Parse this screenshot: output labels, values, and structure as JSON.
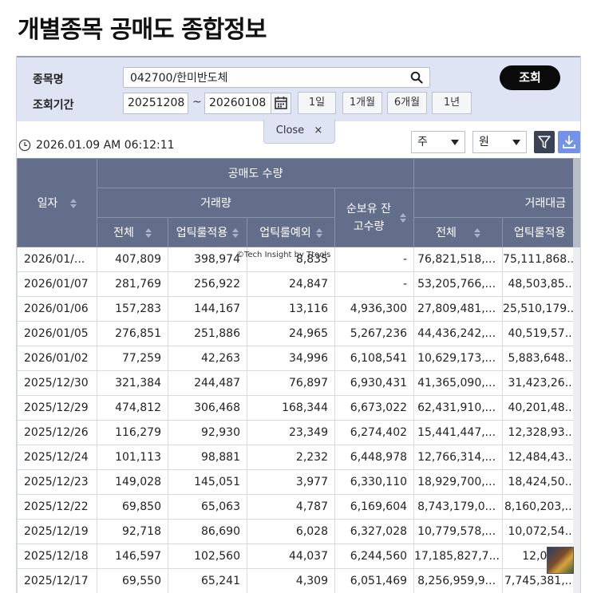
{
  "page_title": "개별종목 공매도 종합정보",
  "filter": {
    "stock_label": "종목명",
    "stock_value": "042700/한미반도체",
    "period_label": "조회기간",
    "start_date": "20251208",
    "end_date": "20260108",
    "separator": "~",
    "period_buttons": [
      "1일",
      "1개월",
      "6개월",
      "1년"
    ],
    "query_button": "조회",
    "close_label": "Close",
    "close_symbol": "×"
  },
  "toolbar": {
    "timestamp": "2026.01.09 AM 06:12:11",
    "unit_select": "주",
    "currency_select": "원"
  },
  "table": {
    "headers": {
      "date": "일자",
      "short_qty": "공매도 수량",
      "volume": "거래량",
      "net_balance": "순보유 잔고수량",
      "trade_value": "거래대금",
      "total": "전체",
      "uptick_applied": "업틱룰적용",
      "uptick_exempt": "업틱룰예외",
      "total2": "전체",
      "uptick_applied2": "업틱룰적용"
    },
    "rows": [
      [
        "2026/01/...",
        "407,809",
        "398,974",
        "8,835",
        "-",
        "76,821,518,...",
        "75,111,868..."
      ],
      [
        "2026/01/07",
        "281,769",
        "256,922",
        "24,847",
        "-",
        "53,205,766,...",
        "48,503,85..."
      ],
      [
        "2026/01/06",
        "157,283",
        "144,167",
        "13,116",
        "4,936,300",
        "27,809,481,...",
        "25,510,179..."
      ],
      [
        "2026/01/05",
        "276,851",
        "251,886",
        "24,965",
        "5,267,236",
        "44,436,242,...",
        "40,519,57..."
      ],
      [
        "2026/01/02",
        "77,259",
        "42,263",
        "34,996",
        "6,108,541",
        "10,629,173,...",
        "5,883,648..."
      ],
      [
        "2025/12/30",
        "321,384",
        "244,487",
        "76,897",
        "6,930,431",
        "41,365,090,...",
        "31,423,26..."
      ],
      [
        "2025/12/29",
        "474,812",
        "306,468",
        "168,344",
        "6,673,022",
        "62,431,910,...",
        "40,201,48..."
      ],
      [
        "2025/12/26",
        "116,279",
        "92,930",
        "23,349",
        "6,274,402",
        "15,441,447,...",
        "12,328,93..."
      ],
      [
        "2025/12/24",
        "101,113",
        "98,881",
        "2,232",
        "6,448,978",
        "12,766,314,...",
        "12,484,43..."
      ],
      [
        "2025/12/23",
        "149,028",
        "145,051",
        "3,977",
        "6,330,110",
        "18,929,700,...",
        "18,424,50..."
      ],
      [
        "2025/12/22",
        "69,850",
        "65,063",
        "4,787",
        "6,169,604",
        "8,743,179,0...",
        "8,160,203,..."
      ],
      [
        "2025/12/19",
        "92,718",
        "86,690",
        "6,028",
        "6,327,028",
        "10,779,578,...",
        "10,072,54..."
      ],
      [
        "2025/12/18",
        "146,597",
        "102,560",
        "44,037",
        "6,244,560",
        "17,185,827,7...",
        "12,034,..."
      ],
      [
        "2025/12/17",
        "69,550",
        "65,241",
        "4,309",
        "6,051,469",
        "8,256,959,9...",
        "7,745,381,..."
      ]
    ]
  },
  "watermark": "©Tech Insight by Ttools"
}
